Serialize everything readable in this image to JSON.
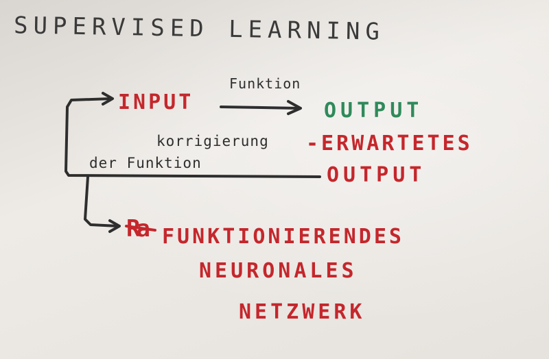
{
  "title": "SUPERVISED LEARNING",
  "nodes": {
    "input": "INPUT",
    "function_label": "Funktion",
    "output": "OUTPUT",
    "correction_line1": "korrigierung",
    "correction_line2": "der Funktion",
    "expected_line1": "-ERWARTETES",
    "expected_line2": "OUTPUT",
    "crossed_out": "Ra",
    "result_line1": "FUNKTIONIERENDES",
    "result_line2": "NEURONALES",
    "result_line3": "NETZWERK"
  },
  "colors": {
    "ink_black": "#2e2e2e",
    "ink_red": "#c4272c",
    "ink_green": "#2f8a5a",
    "paper": "#e9e6e2"
  }
}
